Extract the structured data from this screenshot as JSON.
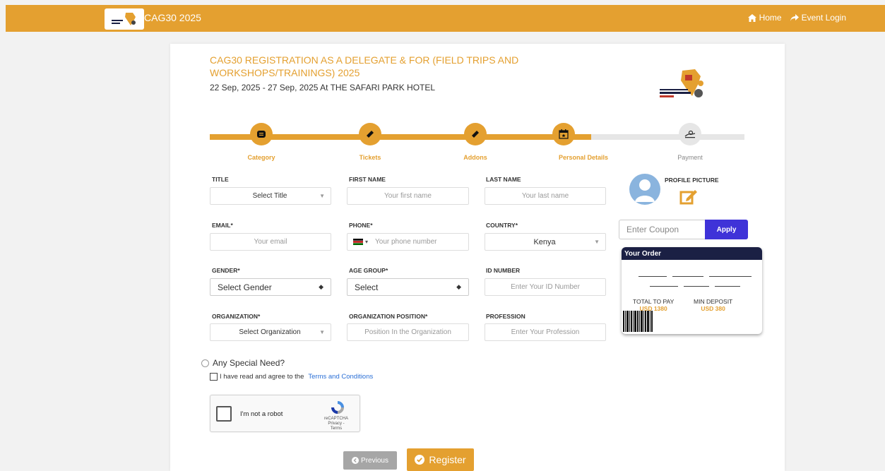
{
  "header": {
    "brand": "CAG30 2025",
    "home_label": "Home",
    "login_label": "Event Login",
    "bg_color": "#e4a030"
  },
  "event": {
    "title": "CAG30 REGISTRATION AS A DELEGATE & FOR (FIELD TRIPS AND WORKSHOPS/TRAININGS) 2025",
    "date_venue": "22 Sep, 2025 - 27 Sep, 2025  At THE SAFARI PARK HOTEL"
  },
  "steps": [
    {
      "label": "Category",
      "icon": "list-icon",
      "state": "done"
    },
    {
      "label": "Tickets",
      "icon": "ticket-icon",
      "state": "done"
    },
    {
      "label": "Addons",
      "icon": "ticket-icon",
      "state": "done"
    },
    {
      "label": "Personal Details",
      "icon": "calendar-icon",
      "state": "current"
    },
    {
      "label": "Payment",
      "icon": "payment-icon",
      "state": "todo"
    }
  ],
  "form": {
    "title": {
      "label": "TITLE",
      "value": "Select Title"
    },
    "first_name": {
      "label": "FIRST NAME",
      "placeholder": "Your first name"
    },
    "last_name": {
      "label": "LAST NAME",
      "placeholder": "Your last name"
    },
    "email": {
      "label": "EMAIL*",
      "placeholder": "Your email"
    },
    "phone": {
      "label": "PHONE*",
      "placeholder": "Your phone number"
    },
    "country": {
      "label": "COUNTRY*",
      "value": "Kenya"
    },
    "gender": {
      "label": "GENDER*",
      "value": "Select Gender"
    },
    "age_group": {
      "label": "AGE GROUP*",
      "value": "Select"
    },
    "id_number": {
      "label": "ID NUMBER",
      "placeholder": "Enter Your ID Number"
    },
    "organization": {
      "label": "ORGANIZATION*",
      "value": "Select Organization"
    },
    "org_position": {
      "label": "ORGANIZATION POSITION*",
      "placeholder": "Position In the Organization"
    },
    "profession": {
      "label": "PROFESSION",
      "placeholder": "Enter Your Profession"
    }
  },
  "profile": {
    "label": "PROFILE PICTURE"
  },
  "coupon": {
    "placeholder": "Enter Coupon",
    "apply_label": "Apply"
  },
  "order": {
    "title": "Your Order",
    "total_label": "TOTAL TO PAY",
    "total_value": "USD 1380",
    "deposit_label": "MIN DEPOSIT",
    "deposit_value": "USD 380"
  },
  "special_need": "Any Special Need?",
  "agree": {
    "text": "I have read and agree to the",
    "link": "Terms and Conditions"
  },
  "captcha": {
    "text": "I'm not a robot",
    "brand": "reCAPTCHA",
    "links": "Privacy - Terms"
  },
  "buttons": {
    "previous": "Previous",
    "register": "Register"
  }
}
